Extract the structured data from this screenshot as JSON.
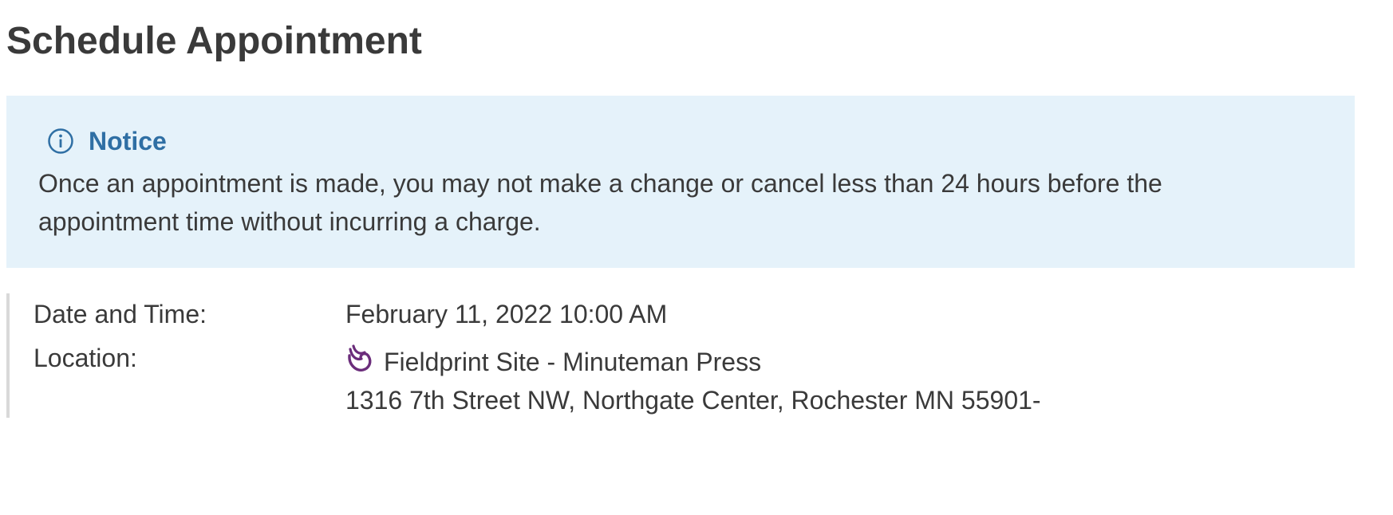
{
  "page": {
    "title": "Schedule Appointment"
  },
  "notice": {
    "icon": "info-circle-icon",
    "title": "Notice",
    "text": "Once an appointment is made, you may not make a change or cancel less than 24 hours before the appointment time without incurring a charge.",
    "background_color": "#e5f2fa",
    "title_color": "#2f6fa4"
  },
  "details": {
    "date_time_label": "Date and Time:",
    "date_time_value": "February 11, 2022 10:00 AM",
    "location_label": "Location:",
    "location_icon": "fieldprint-logo-icon",
    "location_icon_color": "#6b2d7b",
    "location_name": "Fieldprint Site - Minuteman Press",
    "location_address": "1316 7th Street NW, Northgate Center, Rochester MN 55901-"
  }
}
